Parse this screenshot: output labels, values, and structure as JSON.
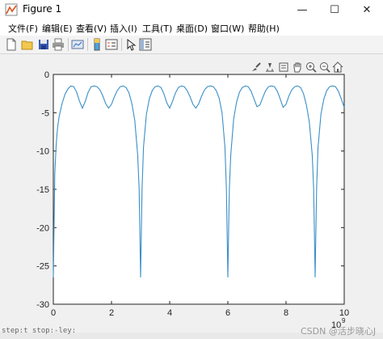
{
  "window": {
    "title": "Figure 1",
    "controls": {
      "minimize": "—",
      "maximize": "☐",
      "close": "✕"
    }
  },
  "menu": [
    {
      "label": "文件(F)"
    },
    {
      "label": "编辑(E)"
    },
    {
      "label": "查看(V)"
    },
    {
      "label": "插入(I)"
    },
    {
      "label": "工具(T)"
    },
    {
      "label": "桌面(D)"
    },
    {
      "label": "窗口(W)"
    },
    {
      "label": "帮助(H)"
    }
  ],
  "toolbar": [
    "new-figure-icon",
    "open-file-icon",
    "save-icon",
    "print-icon",
    "link-plot-icon",
    "insert-colorbar-icon",
    "insert-legend-icon",
    "edit-plot-icon",
    "property-inspector-icon"
  ],
  "axes_toolbar": [
    "brush-icon",
    "data-tips-icon",
    "restore-view-icon",
    "pan-icon",
    "zoom-in-icon",
    "zoom-out-icon",
    "home-icon"
  ],
  "chart_data": {
    "type": "line",
    "title": "",
    "xlabel": "",
    "ylabel": "",
    "xlim": [
      0,
      10
    ],
    "ylim": [
      -30,
      0
    ],
    "x_exponent_label": "10",
    "x_exponent_power": "9",
    "x_ticks": [
      "0",
      "2",
      "4",
      "6",
      "8",
      "10"
    ],
    "y_ticks": [
      "0",
      "-5",
      "-10",
      "-15",
      "-20",
      "-25",
      "-30"
    ],
    "grid": false,
    "series": [
      {
        "color": "#3a8fc8",
        "x": [
          0.0,
          0.05,
          0.1,
          0.15,
          0.2,
          0.3,
          0.4,
          0.5,
          0.6,
          0.7,
          0.8,
          0.9,
          1.0,
          1.1,
          1.2,
          1.3,
          1.4,
          1.5,
          1.6,
          1.7,
          1.8,
          1.9,
          2.0,
          2.1,
          2.2,
          2.3,
          2.4,
          2.5,
          2.6,
          2.7,
          2.8,
          2.9,
          2.95,
          3.0,
          3.05,
          3.1,
          3.2,
          3.3,
          3.4,
          3.5,
          3.6,
          3.7,
          3.8,
          3.9,
          4.0,
          4.1,
          4.2,
          4.3,
          4.4,
          4.5,
          4.6,
          4.7,
          4.8,
          4.9,
          5.0,
          5.1,
          5.2,
          5.3,
          5.4,
          5.5,
          5.6,
          5.7,
          5.8,
          5.9,
          5.95,
          6.0,
          6.05,
          6.1,
          6.2,
          6.3,
          6.4,
          6.5,
          6.6,
          6.7,
          6.8,
          6.9,
          7.0,
          7.1,
          7.2,
          7.3,
          7.4,
          7.5,
          7.6,
          7.7,
          7.8,
          7.9,
          8.0,
          8.1,
          8.2,
          8.3,
          8.4,
          8.5,
          8.6,
          8.7,
          8.8,
          8.9,
          8.95,
          9.0,
          9.05,
          9.1,
          9.2,
          9.3,
          9.4,
          9.5,
          9.6,
          9.7,
          9.8,
          9.9,
          10.0
        ],
        "y": [
          -26.5,
          -13.0,
          -9.0,
          -6.8,
          -5.5,
          -3.8,
          -2.6,
          -1.9,
          -1.5,
          -1.6,
          -2.3,
          -3.5,
          -4.4,
          -3.5,
          -2.3,
          -1.6,
          -1.5,
          -1.6,
          -2.0,
          -2.8,
          -3.8,
          -4.4,
          -3.9,
          -2.9,
          -2.1,
          -1.6,
          -1.5,
          -1.7,
          -2.4,
          -3.8,
          -6.0,
          -10.5,
          -15.0,
          -26.5,
          -15.0,
          -9.5,
          -5.2,
          -3.2,
          -2.1,
          -1.6,
          -1.5,
          -1.7,
          -2.5,
          -3.7,
          -4.4,
          -3.5,
          -2.4,
          -1.7,
          -1.5,
          -1.6,
          -2.1,
          -2.9,
          -3.9,
          -4.4,
          -3.8,
          -2.8,
          -2.0,
          -1.6,
          -1.5,
          -1.6,
          -2.1,
          -3.1,
          -5.0,
          -9.5,
          -15.0,
          -26.5,
          -15.0,
          -10.5,
          -5.8,
          -3.6,
          -2.3,
          -1.7,
          -1.5,
          -1.6,
          -2.2,
          -3.2,
          -4.2,
          -4.0,
          -3.0,
          -2.1,
          -1.6,
          -1.5,
          -1.6,
          -2.2,
          -3.2,
          -4.3,
          -3.9,
          -2.8,
          -2.0,
          -1.6,
          -1.5,
          -1.7,
          -2.5,
          -4.0,
          -6.2,
          -10.5,
          -15.0,
          -26.5,
          -15.0,
          -9.5,
          -5.2,
          -3.2,
          -2.1,
          -1.6,
          -1.5,
          -1.6,
          -2.2,
          -3.2,
          -4.3
        ]
      }
    ]
  },
  "watermark": "CSDN @活步晓心J",
  "bottom_text": "step:t stop:-ley:"
}
